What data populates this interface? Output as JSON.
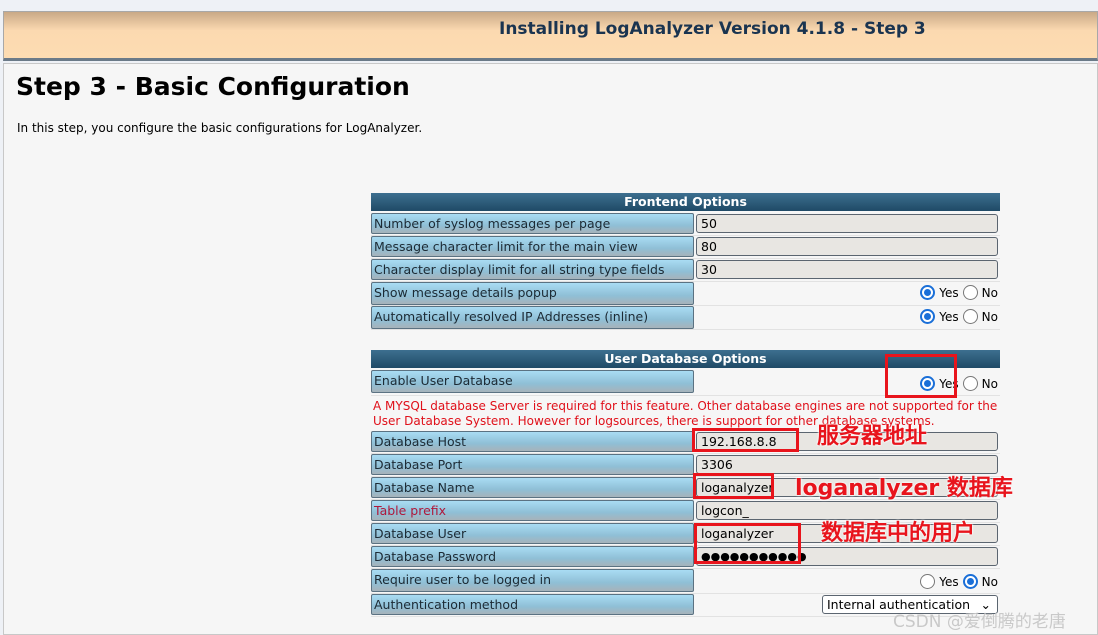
{
  "header": {
    "title": "Installing LogAnalyzer Version 4.1.8 - Step 3"
  },
  "page": {
    "title": "Step 3 - Basic Configuration",
    "intro": "In this step, you configure the basic configurations for LogAnalyzer."
  },
  "frontend": {
    "title": "Frontend Options",
    "messages_per_page": {
      "label": "Number of syslog messages per page",
      "value": "50"
    },
    "char_limit": {
      "label": "Message character limit for the main view",
      "value": "80"
    },
    "display_limit": {
      "label": "Character display limit for all string type fields",
      "value": "30"
    },
    "details_popup": {
      "label": "Show message details popup",
      "yes": "Yes",
      "no": "No",
      "selected": "Yes"
    },
    "resolve_ip": {
      "label": "Automatically resolved IP Addresses (inline)",
      "yes": "Yes",
      "no": "No",
      "selected": "Yes"
    }
  },
  "userdb": {
    "title": "User Database Options",
    "enable": {
      "label": "Enable User Database",
      "yes": "Yes",
      "no": "No",
      "selected": "Yes"
    },
    "warning": "A MYSQL database Server is required for this feature. Other database engines are not supported for the User Database System. However for logsources, there is support for other database systems.",
    "host": {
      "label": "Database Host",
      "value": "192.168.8.8"
    },
    "port": {
      "label": "Database Port",
      "value": "3306"
    },
    "name": {
      "label": "Database Name",
      "value": "loganalyzer"
    },
    "prefix": {
      "label": "Table prefix",
      "value": "logcon_"
    },
    "user": {
      "label": "Database User",
      "value": "loganalyzer"
    },
    "password": {
      "label": "Database Password",
      "value": "●●●●●●●●●●●"
    },
    "require_login": {
      "label": "Require user to be logged in",
      "yes": "Yes",
      "no": "No",
      "selected": "No"
    },
    "auth_method": {
      "label": "Authentication method",
      "value": "Internal authentication"
    }
  },
  "annotations": {
    "host": "服务器地址",
    "dbname": "loganalyzer 数据库",
    "dbuser": "数据库中的用户"
  },
  "watermark": "CSDN @爱倒腾的老唐"
}
